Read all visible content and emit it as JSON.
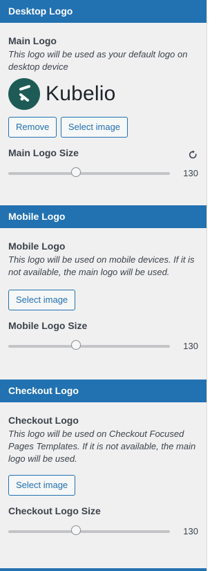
{
  "desktop": {
    "header": "Desktop Logo",
    "main_logo_label": "Main Logo",
    "main_logo_desc": "This logo will be used as your default logo on desktop device",
    "logo_text": "Kubelio",
    "remove_label": "Remove",
    "select_label": "Select image",
    "size_label": "Main Logo Size",
    "size_value": "130",
    "size_fraction": 0.42
  },
  "mobile": {
    "header": "Mobile Logo",
    "logo_label": "Mobile Logo",
    "desc": "This logo will be used on mobile devices. If it is not available, the main logo will be used.",
    "select_label": "Select image",
    "size_label": "Mobile Logo Size",
    "size_value": "130",
    "size_fraction": 0.42
  },
  "checkout": {
    "header": "Checkout Logo",
    "logo_label": "Checkout Logo",
    "desc": "This logo will be used on Checkout Focused Pages Templates. If it is not available, the main logo will be used.",
    "select_label": "Select image",
    "size_label": "Checkout Logo Size",
    "size_value": "130",
    "size_fraction": 0.42
  },
  "icons": {
    "reset": "reset-icon",
    "logo_mark": "kubelio-logo-mark"
  },
  "colors": {
    "header_bg": "#2271b1",
    "panel_bg": "#f0f0f1",
    "logo_circle": "#1e5b57"
  }
}
